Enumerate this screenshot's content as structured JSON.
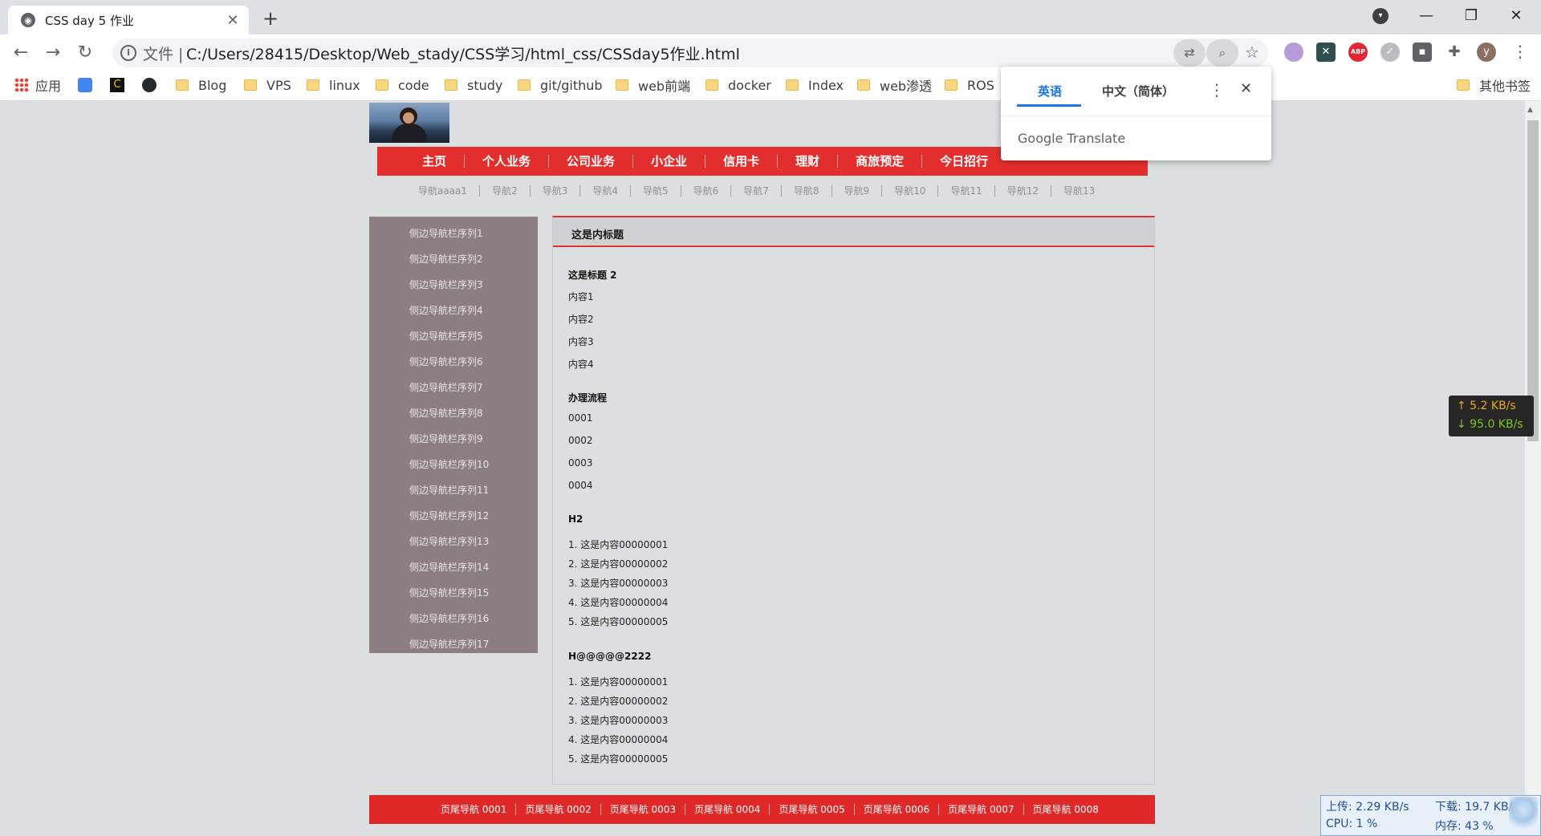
{
  "browser": {
    "tab_title": "CSS day 5 作业",
    "tab_close": "✕",
    "new_tab": "+",
    "window_controls": [
      "—",
      "❐",
      "✕"
    ],
    "url_label": "文件 |",
    "url": "C:/Users/28415/Desktop/Web_stady/CSS学习/html_css/CSSday5作业.html",
    "profile_initial": "y",
    "bookmarks": [
      {
        "label": "应用",
        "icon": "apps-grid-icon"
      },
      {
        "label": "",
        "icon": "translate-icon"
      },
      {
        "label": "",
        "icon": "c-logo-icon"
      },
      {
        "label": "",
        "icon": "github-icon"
      },
      {
        "label": "Blog",
        "icon": "folder-icon"
      },
      {
        "label": "VPS",
        "icon": "folder-icon"
      },
      {
        "label": "linux",
        "icon": "folder-icon"
      },
      {
        "label": "code",
        "icon": "folder-icon"
      },
      {
        "label": "study",
        "icon": "folder-icon"
      },
      {
        "label": "git/github",
        "icon": "folder-icon"
      },
      {
        "label": "web前端",
        "icon": "folder-icon"
      },
      {
        "label": "docker",
        "icon": "folder-icon"
      },
      {
        "label": "Index",
        "icon": "folder-icon"
      },
      {
        "label": "web渗透",
        "icon": "folder-icon"
      },
      {
        "label": "ROS",
        "icon": "folder-icon"
      }
    ],
    "other_bookmarks": "其他书签"
  },
  "translate_popup": {
    "tab_source": "英语",
    "tab_target": "中文（简体）",
    "brand": "Google Translate",
    "active_color": "#1a73e8"
  },
  "page": {
    "main_nav": [
      "主页",
      "个人业务",
      "公司业务",
      "小企业",
      "信用卡",
      "理财",
      "商旅预定",
      "今日招行"
    ],
    "sub_nav": [
      "导航aaaa1",
      "导航2",
      "导航3",
      "导航4",
      "导航5",
      "导航6",
      "导航7",
      "导航8",
      "导航9",
      "导航10",
      "导航11",
      "导航12",
      "导航13"
    ],
    "sidebar": [
      "侧边导航栏序列1",
      "侧边导航栏序列2",
      "侧边导航栏序列3",
      "侧边导航栏序列4",
      "侧边导航栏序列5",
      "侧边导航栏序列6",
      "侧边导航栏序列7",
      "侧边导航栏序列8",
      "侧边导航栏序列9",
      "侧边导航栏序列10",
      "侧边导航栏序列11",
      "侧边导航栏序列12",
      "侧边导航栏序列13",
      "侧边导航栏序列14",
      "侧边导航栏序列15",
      "侧边导航栏序列16",
      "侧边导航栏序列17"
    ],
    "content_title": "这是内标题",
    "sections": [
      {
        "heading": "这是标题 2",
        "items": [
          "内容1",
          "内容2",
          "内容3",
          "内容4"
        ]
      },
      {
        "heading": "办理流程",
        "items": [
          "0001",
          "0002",
          "0003",
          "0004"
        ]
      },
      {
        "heading": "H2",
        "items": [
          "1. 这是内容00000001",
          "2. 这是内容00000002",
          "3. 这是内容00000003",
          "4. 这是内容00000004",
          "5. 这是内容00000005"
        ]
      },
      {
        "heading": "H@@@@@2222",
        "items": [
          "1. 这是内容00000001",
          "2. 这是内容00000002",
          "3. 这是内容00000003",
          "4. 这是内容00000004",
          "5. 这是内容00000005"
        ]
      }
    ],
    "footer_nav": [
      "页尾导航 0001",
      "页尾导航 0002",
      "页尾导航 0003",
      "页尾导航 0004",
      "页尾导航 0005",
      "页尾导航 0006",
      "页尾导航 0007",
      "页尾导航 0008"
    ],
    "accent_color": "#e32e2e"
  },
  "net_monitor": {
    "upload": "↑ 5.2 KB/s",
    "download": "↓ 95.0 KB/s"
  },
  "system_monitor": {
    "upload": "上传: 2.29 KB/s",
    "download": "下载: 19.7 KB/s",
    "cpu": "CPU: 1 %",
    "memory": "内存: 43 %"
  }
}
